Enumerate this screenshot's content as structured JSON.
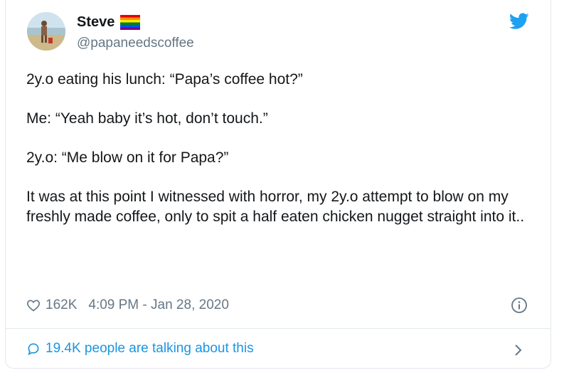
{
  "author": {
    "display_name": "Steve",
    "handle": "@papaneedscoffee",
    "flag_icon": "rainbow-flag-icon"
  },
  "brand": {
    "icon": "twitter-bird-icon",
    "color": "#1da1f2"
  },
  "tweet": {
    "paragraphs": [
      "2y.o eating his lunch: “Papa’s coffee hot?”",
      "Me: “Yeah baby it’s hot, don’t touch.”",
      "2y.o: “Me blow on it for Papa?”",
      "It was at this point I witnessed with horror, my 2y.o attempt to blow on my freshly made coffee, only to spit a half eaten chicken nugget straight into it.."
    ]
  },
  "meta": {
    "likes": "162K",
    "timestamp": "4:09 PM - Jan 28, 2020",
    "like_icon": "heart-icon",
    "info_icon": "info-icon"
  },
  "conversation": {
    "label": "19.4K people are talking about this",
    "icon": "reply-bubble-icon",
    "chevron_icon": "chevron-right-icon",
    "link_color": "#1b95e0"
  }
}
